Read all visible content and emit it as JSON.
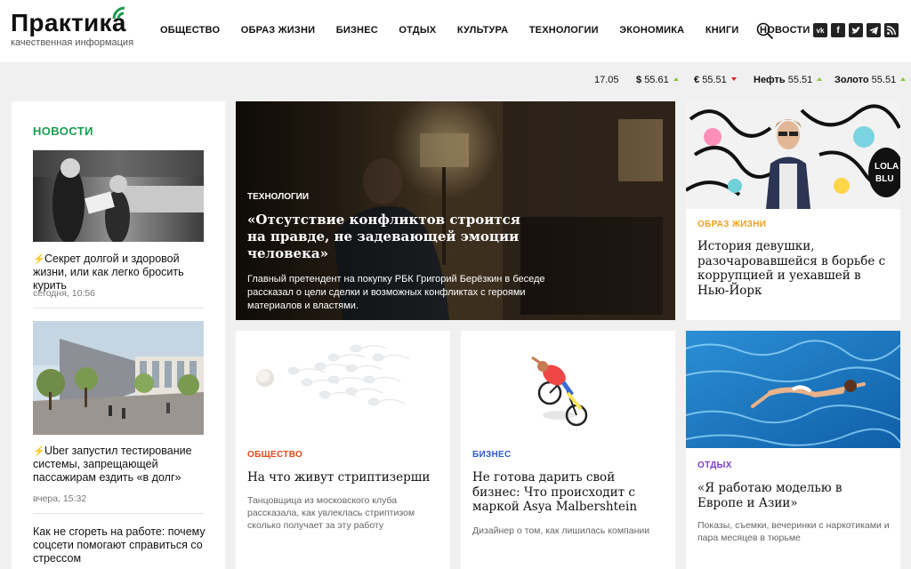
{
  "logo": {
    "name": "Практика",
    "tagline": "качественная информация"
  },
  "nav": [
    "ОБЩЕСТВО",
    "ОБРАЗ ЖИЗНИ",
    "БИЗНЕС",
    "ОТДЫХ",
    "КУЛЬТУРА",
    "ТЕХНОЛОГИИ",
    "ЭКОНОМИКА",
    "КНИГИ",
    "НОВОСТИ"
  ],
  "socials": [
    "vk",
    "f",
    "twitter",
    "telegram",
    "rss"
  ],
  "rates": {
    "date": "17.05",
    "usd_label": "$",
    "usd": "55.61",
    "eur_label": "€",
    "eur": "55.51",
    "oil_label": "Нефть",
    "oil": "55.51",
    "gold_label": "Золото",
    "gold": "55.51"
  },
  "news": {
    "heading": "НОВОСТИ",
    "items": [
      {
        "title": "Секрет долгой и здоровой жизни, или как легко бросить курить",
        "time": "сегодня, 10:56"
      },
      {
        "title": "Uber запустил тестирование системы, запрещающей пассажирам ездить «в долг»",
        "time": "вчера, 15:32"
      },
      {
        "title": "Как не сгореть на работе: почему соцсети помогают справиться со стрессом",
        "time": ""
      }
    ]
  },
  "hero": {
    "category": "ТЕХНОЛОГИИ",
    "title": "«Отсутствие конфликтов строится на правде, не задевающей эмоции человека»",
    "desc": "Главный претендент на покупку РБК Григорий Берёзкин в беседе рассказал о цели сделки и возможных конфликтах с героями материалов и властями."
  },
  "cards": [
    {
      "category": "ОБРАЗ ЖИЗНИ",
      "color": "#f0a020",
      "title": "История девушки, разочаровавшейся в борьбе с коррупцией и уехавшей в Нью-Йорк",
      "desc": ""
    },
    {
      "category": "ОБЩЕСТВО",
      "color": "#e0491c",
      "title": "На что живут стриптизерши",
      "desc": "Танцовщица из московского клуба рассказала, как увлеклась стриптизом сколько получает за эту работу"
    },
    {
      "category": "БИЗНЕС",
      "color": "#2a5bd0",
      "title": "Не готова дарить свой бизнес: Что происходит с маркой Asya Malbershtein",
      "desc": "Дизайнер о том, как лишилась компании"
    },
    {
      "category": "ОТДЫХ",
      "color": "#7b3fc4",
      "title": "«Я работаю моделью в Европе и Азии»",
      "desc": "Показы, съемки, вечеринки с наркотиками и пара месяцев в тюрьме"
    }
  ],
  "colors": {
    "brand_green": "#1a9c52",
    "bolt": "#e0491c",
    "rate_up": "#8ac53f",
    "rate_down": "#e02020"
  }
}
